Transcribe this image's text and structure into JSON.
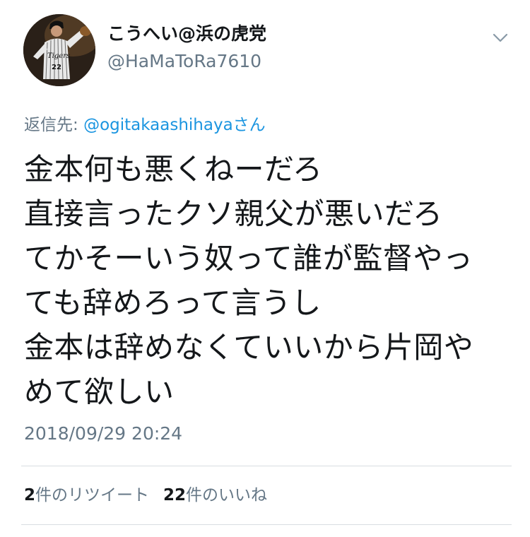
{
  "tweet": {
    "display_name": "こうへい@浜の虎党",
    "handle": "@HaMaToRa7610",
    "reply_prefix": "返信先: ",
    "reply_target": "@ogitakaashihaya",
    "reply_suffix": "さん",
    "text_lines": [
      "金本何も悪くねーだろ",
      "直接言ったクソ親父が悪いだろ",
      "てかそーいう奴って誰が監督やっ",
      "ても辞めろって言うし",
      "金本は辞めなくていいから片岡や",
      "めて欲しい"
    ],
    "timestamp": "2018/09/29 20:24",
    "retweet_count": "2",
    "retweet_label": "件のリツイート",
    "like_count": "22",
    "like_label": "件のいいね"
  },
  "icons": {
    "menu": "chevron-down-icon",
    "avatar": "baseball-player-avatar"
  },
  "colors": {
    "text": "#14171a",
    "secondary": "#657786",
    "link": "#1b95e0",
    "divider": "#d9dde1"
  }
}
